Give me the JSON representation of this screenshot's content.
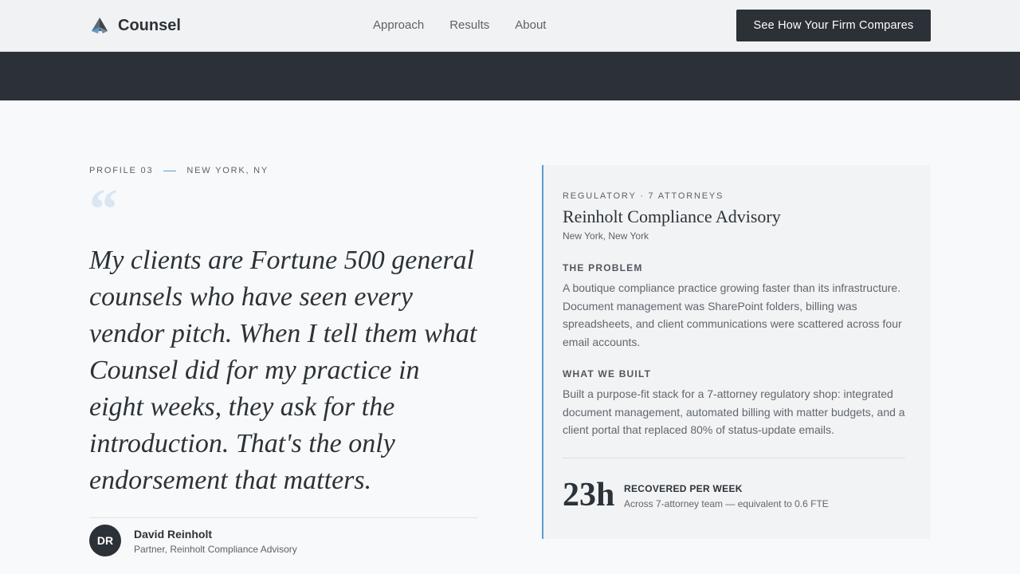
{
  "nav": {
    "brand": "Counsel",
    "links": [
      "Approach",
      "Results",
      "About"
    ],
    "cta": "See How Your Firm Compares"
  },
  "profile": {
    "number": "PROFILE 03",
    "location": "NEW YORK, NY",
    "quote_mark": "“",
    "quote": "My clients are Fortune 500 general counsels who have seen every vendor pitch. When I tell them what Counsel did for my practice in eight weeks, they ask for the introduction. That's the only endorsement that matters.",
    "author": {
      "initials": "DR",
      "name": "David Reinholt",
      "role": "Partner, Reinholt Compliance Advisory"
    }
  },
  "card": {
    "tag": "REGULATORY · 7 ATTORNEYS",
    "title": "Reinholt Compliance Advisory",
    "location": "New York, New York",
    "problem_heading": "THE PROBLEM",
    "problem_body": "A boutique compliance practice growing faster than its infrastructure. Document management was SharePoint folders, billing was spreadsheets, and client communications were scattered across four email accounts.",
    "built_heading": "WHAT WE BUILT",
    "built_body": "Built a purpose-fit stack for a 7-attorney regulatory shop: integrated document management, automated billing with matter budgets, and a client portal that replaced 80% of status-update emails.",
    "stat": {
      "value": "23h",
      "label": "RECOVERED PER WEEK",
      "sub": "Across 7-attorney team — equivalent to 0.6 FTE"
    }
  },
  "colors": {
    "accent": "#5b9bd5",
    "dark": "#2b3136",
    "background": "#f8f9fa",
    "card": "#f1f3f5"
  }
}
